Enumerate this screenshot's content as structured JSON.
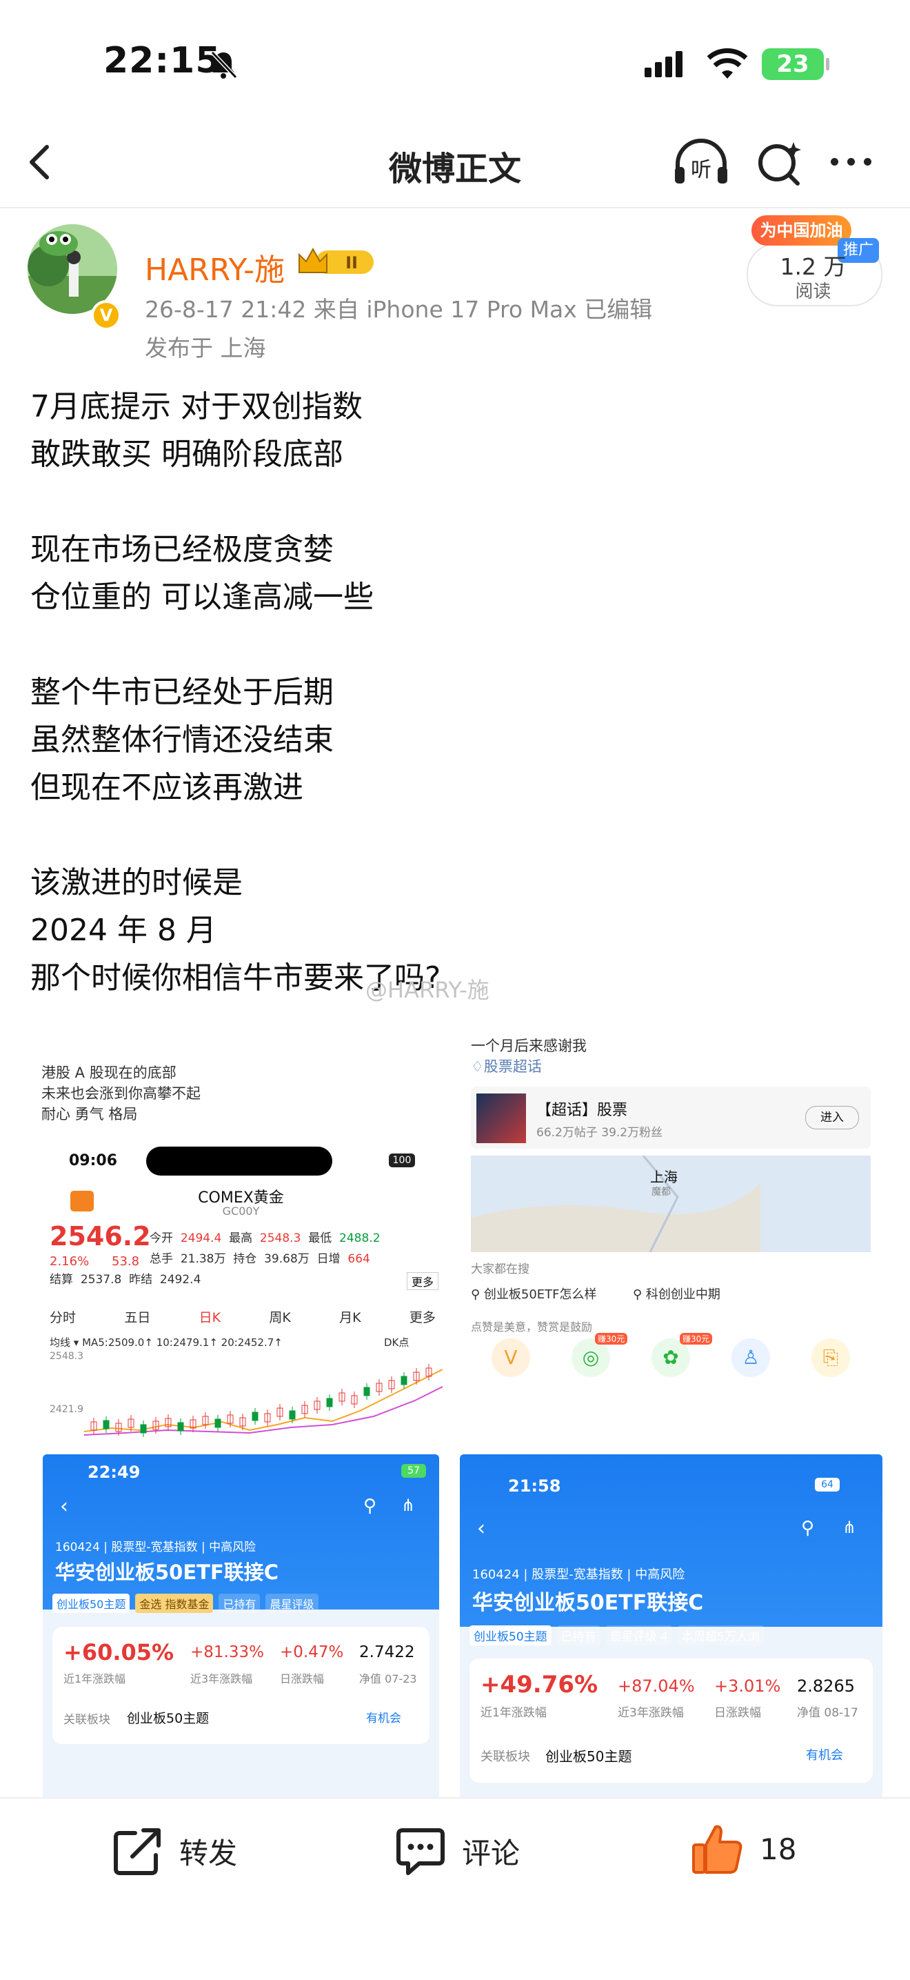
{
  "status_bar": {
    "time": "22:15",
    "battery": "23"
  },
  "nav": {
    "title": "微博正文"
  },
  "author": {
    "name": "HARRY-施",
    "level": "II",
    "meta": "26-8-17 21:42  来自 iPhone 17 Pro Max  已编辑",
    "location": "发布于 上海",
    "promo": "为中国加油",
    "ad_label": "推广",
    "read_count": "1.2 万",
    "read_label": "阅读"
  },
  "post": {
    "text": "7月底提示 对于双创指数\n敢跌敢买 明确阶段底部\n\n现在市场已经极度贪婪\n仓位重的 可以逢高减一些\n\n整个牛市已经处于后期\n虽然整体行情还没结束\n但现在不应该再激进\n\n该激进的时候是\n2024 年 8 月\n那个时候你相信牛市要来了吗?",
    "watermark": "@HARRY-施"
  },
  "shot1": {
    "lines": [
      "港股 A 股现在的底部",
      "未来也会涨到你高攀不起",
      "耐心 勇气 格局"
    ],
    "time": "09:06",
    "battery": "100",
    "title": "COMEX黄金",
    "code": "GC00Y",
    "price": "2546.2",
    "pct": "2.16%",
    "chg": "53.8",
    "open_label": "今开",
    "open": "2494.4",
    "high_label": "最高",
    "high": "2548.3",
    "low_label": "最低",
    "low": "2488.2",
    "vol_label": "总手",
    "vol": "21.38万",
    "hold_label": "持仓",
    "hold": "39.68万",
    "daychg_label": "日增",
    "daychg": "664",
    "settle_label": "结算",
    "settle": "2537.8",
    "prev_label": "昨结",
    "prev": "2492.4",
    "more": "更多",
    "tabs": [
      "分时",
      "五日",
      "日K",
      "周K",
      "月K",
      "更多"
    ],
    "ma": "均线 ▾  MA5:2509.0↑  10:2479.1↑  20:2452.7↑",
    "dk": "DK点",
    "y1": "2548.3",
    "y2": "2421.9"
  },
  "shot2": {
    "line": "一个月后来感谢我",
    "topic": "股票超话",
    "card_title": "【超话】股票",
    "card_sub": "66.2万帖子 39.2万粉丝",
    "enter": "进入",
    "map_city": "上海",
    "map_sub": "魔都",
    "search_label": "大家都在搜",
    "search1": "创业板50ETF怎么样",
    "search2": "科创创业中期",
    "like_hint": "点赞是美意，赞赏是鼓励",
    "coupon": "赚30元"
  },
  "shot3": {
    "time": "22:49",
    "battery": "57",
    "code_line": "160424 | 股票型-宽基指数 | 中高风险",
    "fund_name": "华安创业板50ETF联接C",
    "tags": [
      "创业板50主题",
      "金选 指数基金",
      "已持有",
      "晨星评级"
    ],
    "r1": "+60.05%",
    "r1_label": "近1年涨跌幅",
    "r3": "+81.33%",
    "r3_label": "近3年涨跌幅",
    "rd": "+0.47%",
    "rd_label": "日涨跌幅",
    "nav": "2.7422",
    "nav_label": "净值 07-23",
    "sector_label": "关联板块",
    "sector": "创业板50主题",
    "chance": "有机会"
  },
  "shot4": {
    "time": "21:58",
    "battery": "64",
    "code_line": "160424 | 股票型-宽基指数 | 中高风险",
    "fund_name": "华安创业板50ETF联接C",
    "tags": [
      "创业板50主题",
      "已持有",
      "晨星评级 4",
      "本周超5万人浏"
    ],
    "r1": "+49.76%",
    "r1_label": "近1年涨跌幅",
    "r3": "+87.04%",
    "r3_label": "近3年涨跌幅",
    "rd": "+3.01%",
    "rd_label": "日涨跌幅",
    "nav": "2.8265",
    "nav_label": "净值 08-17",
    "sector_label": "关联板块",
    "sector": "创业板50主题",
    "chance": "有机会"
  },
  "actions": {
    "repost": "转发",
    "comment": "评论",
    "like_count": "18"
  },
  "colors": {
    "accent": "#f26b0f",
    "blue": "#1b7cf0",
    "red": "#e53935"
  }
}
